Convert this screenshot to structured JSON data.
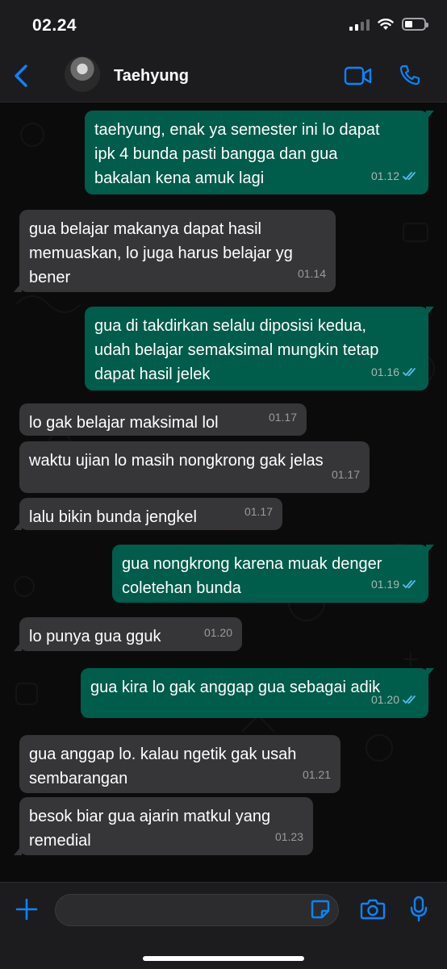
{
  "status_bar": {
    "time": "02.24"
  },
  "header": {
    "contact_name": "Taehyung",
    "accent": "#0a84ff"
  },
  "messages": [
    {
      "dir": "out",
      "lines": [
        "taehyung, enak ya semester ini lo dapat",
        "ipk 4 bunda pasti bangga dan gua",
        "bakalan kena amuk lagi"
      ],
      "time": "01.12",
      "read": true
    },
    {
      "dir": "in",
      "lines": [
        "gua belajar makanya dapat hasil",
        "memuaskan, lo juga harus belajar yg",
        "bener"
      ],
      "time": "01.14"
    },
    {
      "dir": "out",
      "lines": [
        "gua di takdirkan selalu diposisi kedua,",
        "udah belajar semaksimal mungkin tetap",
        "dapat hasil jelek"
      ],
      "time": "01.16",
      "read": true
    },
    {
      "dir": "in",
      "lines": [
        "lo gak belajar maksimal lol"
      ],
      "time": "01.17"
    },
    {
      "dir": "in",
      "lines": [
        "waktu ujian lo masih nongkrong gak jelas"
      ],
      "time": "01.17"
    },
    {
      "dir": "in",
      "lines": [
        "lalu bikin bunda jengkel"
      ],
      "time": "01.17"
    },
    {
      "dir": "out",
      "lines": [
        "gua nongkrong karena muak denger",
        "coletehan bunda"
      ],
      "time": "01.19",
      "read": true
    },
    {
      "dir": "in",
      "lines": [
        "lo punya gua gguk"
      ],
      "time": "01.20"
    },
    {
      "dir": "out",
      "lines": [
        "gua kira lo gak anggap gua sebagai adik"
      ],
      "time": "01.20",
      "read": true
    },
    {
      "dir": "in",
      "lines": [
        "gua anggap lo. kalau ngetik gak usah",
        "sembarangan"
      ],
      "time": "01.21"
    },
    {
      "dir": "in",
      "lines": [
        "besok biar gua ajarin matkul yang",
        "remedial"
      ],
      "time": "01.23"
    }
  ],
  "colors": {
    "outgoing_bubble": "#005c4b",
    "incoming_bubble": "#363638",
    "read_ticks": "#53bdeb"
  },
  "icons": [
    "back-chevron-icon",
    "video-call-icon",
    "phone-icon",
    "plus-icon",
    "sticker-icon",
    "camera-icon",
    "mic-icon"
  ]
}
